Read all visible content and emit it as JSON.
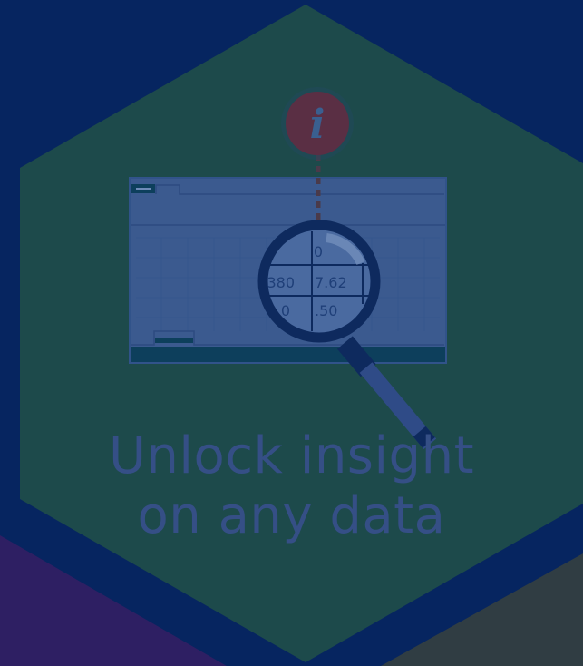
{
  "headline": {
    "line1": "Unlock insight",
    "line2": "on any data"
  },
  "magnifier_cells": {
    "row1": "0",
    "row2_left": "380",
    "row2_right": "7.62",
    "row3_left": "0",
    "row3_right": ".50"
  },
  "info_icon": {
    "glyph": "i"
  },
  "colors": {
    "background": "#062560",
    "hexagon": "#1d4a4b",
    "bottom_left_shape": "#2e1f63",
    "bottom_right_shape": "#303d43",
    "spreadsheet": "#3b5a8f",
    "spreadsheet_footer": "#0d3f5c",
    "headline_text": "#354f86",
    "info_badge": "#5a2f44",
    "magnifier_ring": "#0e2a5e",
    "magnifier_handle": "#2f4b87"
  },
  "icons": [
    "info-icon",
    "magnifier-icon",
    "spreadsheet-icon"
  ]
}
